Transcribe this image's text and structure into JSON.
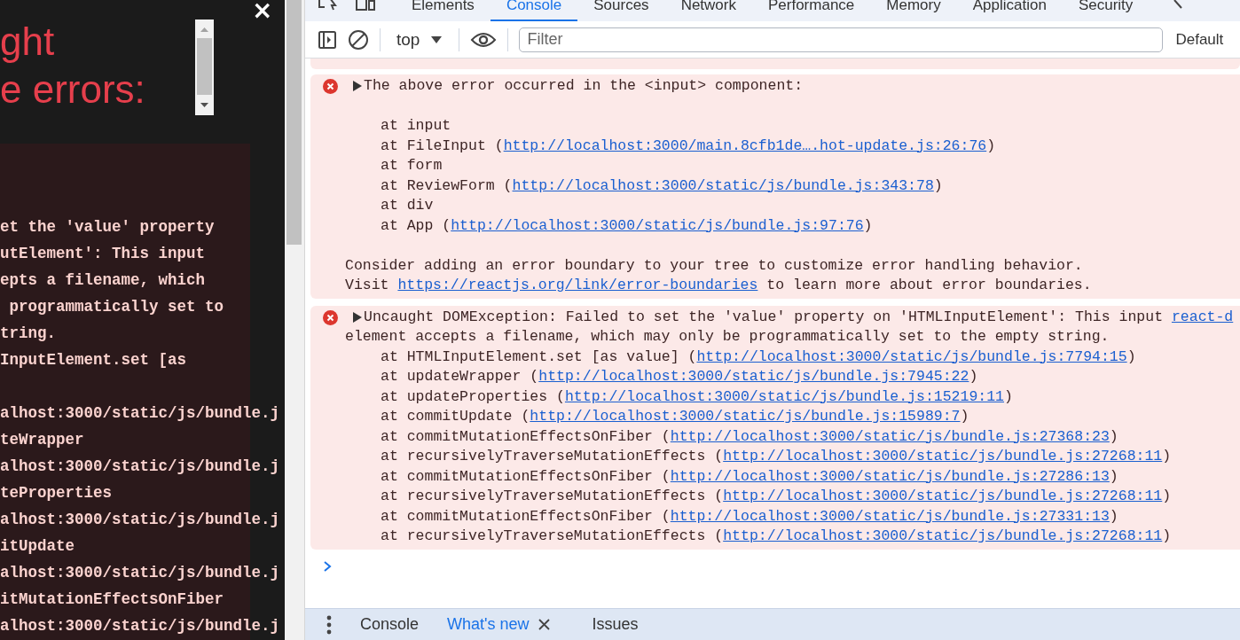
{
  "overlay": {
    "title_lines": [
      "ght",
      "e errors:"
    ],
    "close": "×",
    "code_blocks": [
      [
        "et the 'value' property",
        "utElement': This input",
        "epts a filename, which",
        " programmatically set to",
        "tring.",
        "InputElement.set [as"
      ],
      [
        "alhost:3000/static/js/bundle.j",
        "teWrapper",
        "alhost:3000/static/js/bundle.j",
        "teProperties",
        "alhost:3000/static/js/bundle.j",
        "itUpdate",
        "alhost:3000/static/js/bundle.j",
        "itMutationEffectsOnFiber",
        "alhost:3000/static/js/bundle.j"
      ]
    ]
  },
  "devtools": {
    "tabs": [
      {
        "label": "Elements",
        "selected": false
      },
      {
        "label": "Console",
        "selected": true
      },
      {
        "label": "Sources",
        "selected": false
      },
      {
        "label": "Network",
        "selected": false
      },
      {
        "label": "Performance",
        "selected": false
      },
      {
        "label": "Memory",
        "selected": false
      },
      {
        "label": "Application",
        "selected": false
      },
      {
        "label": "Security",
        "selected": false
      }
    ],
    "toolbar": {
      "context": "top",
      "filter_placeholder": "Filter",
      "levels": "Default"
    },
    "console": {
      "messages": [
        {
          "kind": "component_stack",
          "expanded": false,
          "header": "The above error occurred in the <input> component:",
          "frames": [
            {
              "text": "at input"
            },
            {
              "text": "at FileInput (",
              "link": "http://localhost:3000/main.8cfb1de….hot-update.js:26:76",
              "tail": ")"
            },
            {
              "text": "at form"
            },
            {
              "text": "at ReviewForm (",
              "link": "http://localhost:3000/static/js/bundle.js:343:78",
              "tail": ")"
            },
            {
              "text": "at div"
            },
            {
              "text": "at App (",
              "link": "http://localhost:3000/static/js/bundle.js:97:76",
              "tail": ")"
            }
          ],
          "notes": [
            {
              "text": "Consider adding an error boundary to your tree to customize error handling behavior."
            },
            {
              "text": "Visit ",
              "link": "https://reactjs.org/link/error-boundaries",
              "tail": " to learn more about error boundaries."
            }
          ]
        },
        {
          "kind": "exception",
          "expanded": false,
          "header": "Uncaught DOMException: Failed to set the 'value' property on 'HTMLInputElement': This input ",
          "header_link": "react-d",
          "continuation": "element accepts a filename, which may only be programmatically set to the empty string.",
          "frames": [
            {
              "text": "at HTMLInputElement.set [as value] (",
              "link": "http://localhost:3000/static/js/bundle.js:7794:15",
              "tail": ")"
            },
            {
              "text": "at updateWrapper (",
              "link": "http://localhost:3000/static/js/bundle.js:7945:22",
              "tail": ")"
            },
            {
              "text": "at updateProperties (",
              "link": "http://localhost:3000/static/js/bundle.js:15219:11",
              "tail": ")"
            },
            {
              "text": "at commitUpdate (",
              "link": "http://localhost:3000/static/js/bundle.js:15989:7",
              "tail": ")"
            },
            {
              "text": "at commitMutationEffectsOnFiber (",
              "link": "http://localhost:3000/static/js/bundle.js:27368:23",
              "tail": ")"
            },
            {
              "text": "at recursivelyTraverseMutationEffects (",
              "link": "http://localhost:3000/static/js/bundle.js:27268:11",
              "tail": ")"
            },
            {
              "text": "at commitMutationEffectsOnFiber (",
              "link": "http://localhost:3000/static/js/bundle.js:27286:13",
              "tail": ")"
            },
            {
              "text": "at recursivelyTraverseMutationEffects (",
              "link": "http://localhost:3000/static/js/bundle.js:27268:11",
              "tail": ")"
            },
            {
              "text": "at commitMutationEffectsOnFiber (",
              "link": "http://localhost:3000/static/js/bundle.js:27331:13",
              "tail": ")"
            },
            {
              "text": "at recursivelyTraverseMutationEffects (",
              "link": "http://localhost:3000/static/js/bundle.js:27268:11",
              "tail": ")"
            }
          ]
        }
      ]
    },
    "drawer_tabs": [
      {
        "label": "Console",
        "selected": false,
        "closable": false
      },
      {
        "label": "What's new",
        "selected": true,
        "closable": true
      },
      {
        "label": "Issues",
        "selected": false,
        "closable": false
      }
    ]
  }
}
